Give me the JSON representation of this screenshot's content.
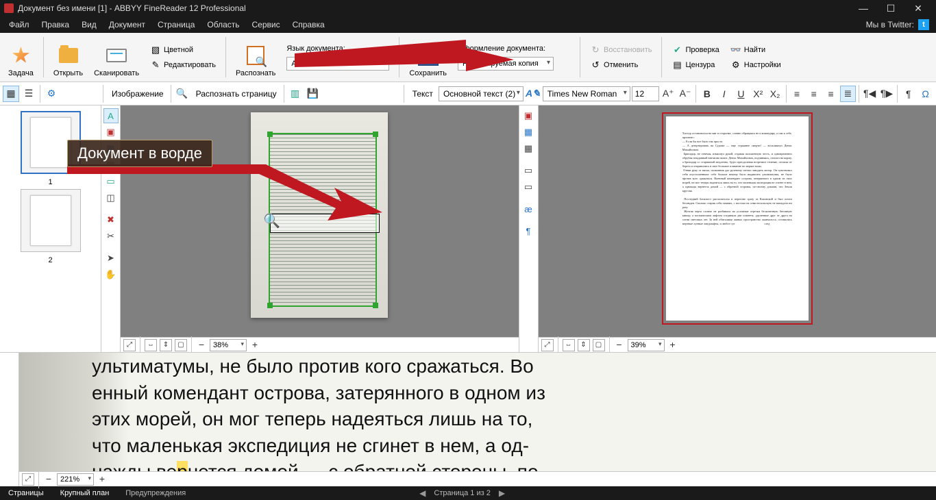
{
  "title": "Документ без имени [1] - ABBYY FineReader 12 Professional",
  "menu": {
    "file": "Файл",
    "edit": "Правка",
    "view": "Вид",
    "doc": "Документ",
    "page": "Страница",
    "area": "Область",
    "service": "Сервис",
    "help": "Справка",
    "twitter": "Мы в Twitter:"
  },
  "ribbon": {
    "task": "Задача",
    "open": "Открыть",
    "scan": "Сканировать",
    "edit": "Редактировать",
    "color": "Цветной",
    "recognize": "Распознать",
    "lang_label": "Язык документа:",
    "lang_value": "Английский",
    "save": "Сохранить",
    "layout_label": "Оформление документа:",
    "layout_value": "Редактируемая копия",
    "restore": "Восстановить",
    "undo": "Отменить",
    "verify": "Проверка",
    "censor": "Цензура",
    "find": "Найти",
    "settings": "Настройки"
  },
  "toolrow": {
    "img_label": "Изображение",
    "recognize_page": "Распознать страницу",
    "text_label": "Текст",
    "style_value": "Основной текст (2)",
    "font_value": "Times New Roman",
    "size_value": "12"
  },
  "thumbs": {
    "p1": "1",
    "p2": "2"
  },
  "callout": "Документ в ворде",
  "page_text": "Хастур остановился на миг в сторонке, словно обращаясь не к командиру, а сам к себе, произнес:\n— Если бы все было так просто.\n— А дезертировать на Судоме — еще страшнее смерти! — воскликнул Денис Михайлович.\n Бригадир, не отвечая, взмахнул рукой, отдавая положенную честь, и одновременно обрубая нежданный внезапно визит. Денис Михайлович, подчиняясь, отошел на корму, а бригадир со старшиной медленно, будто преодолевая встречное течение, отошли от берега и отправились в свое большое плавание по морям тьмы.\n Отняв руку от виска, полковник дал рулевому сигнал заводить мотор. Он чувствовал себя опустошенным: себе больше некому было выдвигать ультиматумы, не было против кого сражаться. Военный комендант острова, затерянного в одном из этих морей, он мог теперь надеяться лишь на то, что маленькая экспедиция не сгинет в нем, а однажды вернется домой — с обратной стороны, по-своему доказав, что Земля круглая.\n\n Последний блокпост располагался в перегоне сразу за Каховской и был почти безлюден. Сколько старик себя помнил, с востока на севастопольскую не нападали ни разу.\n Желтая черта словно не разбивала на условные отрезки бесконечную бетонную кишку, а космическим лифтом соединяла две планеты, удаленные друг от друга на сотни световых лет. За ней обиталище живых пространство оканчалось: оставались мертвые лунные ландшафты, и любое суе                                        след",
  "panes": {
    "img_zoom": "38%",
    "txt_zoom": "39%",
    "large_zoom": "221%"
  },
  "large_text": "ультиматумы, не было против кого сражаться. Во\nенный комендант острова, затерянного в одном из\nэтих морей, он мог теперь надеяться лишь на то,\nчто маленькая экспедиция не сгинет в нем, а од-\nнажды ве",
  "large_text_hl": "р",
  "large_text_tail": "нется домой — с обратной стороны, по-",
  "status": {
    "pages": "Страницы",
    "large": "Крупный план",
    "warns": "Предупреждения",
    "page_of": "Страница 1 из 2"
  }
}
